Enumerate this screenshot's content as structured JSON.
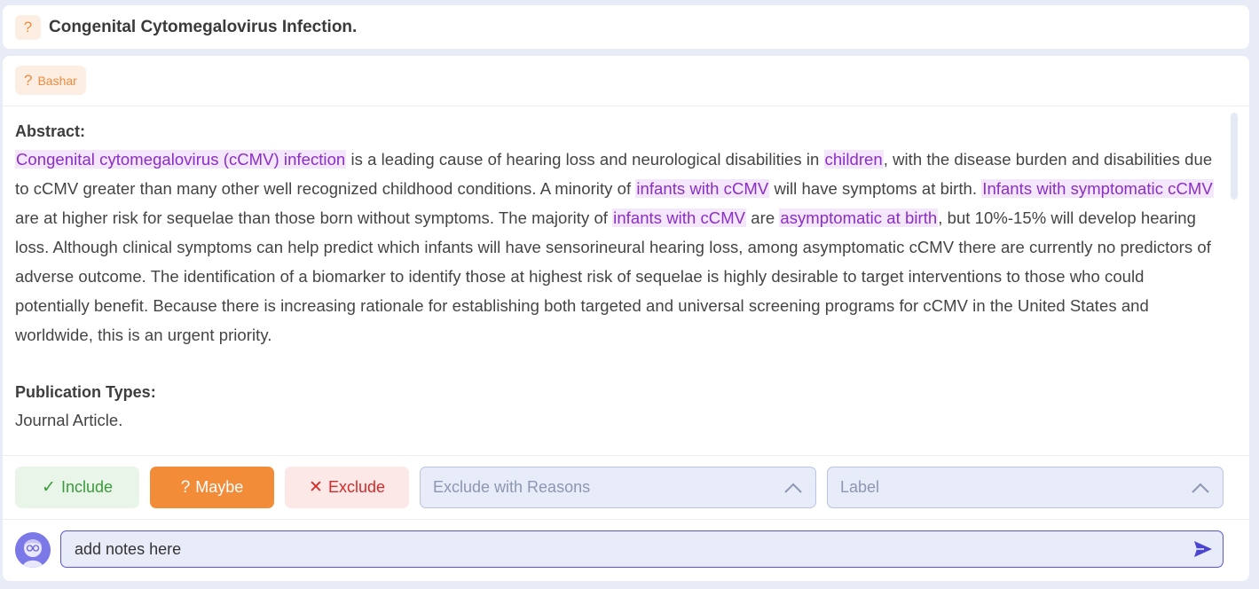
{
  "header": {
    "badge_icon": "?",
    "title": "Congenital Cytomegalovirus Infection."
  },
  "tag": {
    "icon": "?",
    "label": "Bashar"
  },
  "abstract": {
    "heading": "Abstract:",
    "segments": [
      {
        "text": "Congenital cytomegalovirus (cCMV) infection",
        "highlight": true
      },
      {
        "text": " is a leading cause of hearing loss and neurological disabilities in ",
        "highlight": false
      },
      {
        "text": "children",
        "highlight": true
      },
      {
        "text": ", with the disease burden and disabilities due to cCMV greater than many other well recognized childhood conditions. A minority of ",
        "highlight": false
      },
      {
        "text": "infants with cCMV",
        "highlight": true
      },
      {
        "text": " will have symptoms at birth. ",
        "highlight": false
      },
      {
        "text": "Infants with symptomatic cCMV",
        "highlight": true
      },
      {
        "text": " are at higher risk for sequelae than those born without symptoms. The majority of ",
        "highlight": false
      },
      {
        "text": "infants with cCMV",
        "highlight": true
      },
      {
        "text": " are ",
        "highlight": false
      },
      {
        "text": "asymptomatic at birth",
        "highlight": true
      },
      {
        "text": ", but 10%-15% will develop hearing loss. Although clinical symptoms can help predict which infants will have sensorineural hearing loss, among asymptomatic cCMV there are currently no predictors of adverse outcome. The identification of a biomarker to identify those at highest risk of sequelae is highly desirable to target interventions to those who could potentially benefit. Because there is increasing rationale for establishing both targeted and universal screening programs for cCMV in the United States and worldwide, this is an urgent priority.",
        "highlight": false
      }
    ],
    "highlight_color": "#8a2fc4",
    "highlight_bg": "#f4e6fb"
  },
  "publication": {
    "heading": "Publication Types:",
    "value": "Journal Article."
  },
  "actions": {
    "include_label": "Include",
    "include_icon": "✓",
    "maybe_label": "Maybe",
    "maybe_icon": "?",
    "exclude_label": "Exclude",
    "exclude_icon": "✕",
    "reasons_placeholder": "Exclude with Reasons",
    "label_placeholder": "Label"
  },
  "notes": {
    "value": "add notes here",
    "send_icon": "send-icon"
  },
  "colors": {
    "accent_orange": "#f28c38",
    "include_green": "#3b9a3b",
    "exclude_red": "#d42a2a",
    "primary_purple": "#5b54d6"
  }
}
